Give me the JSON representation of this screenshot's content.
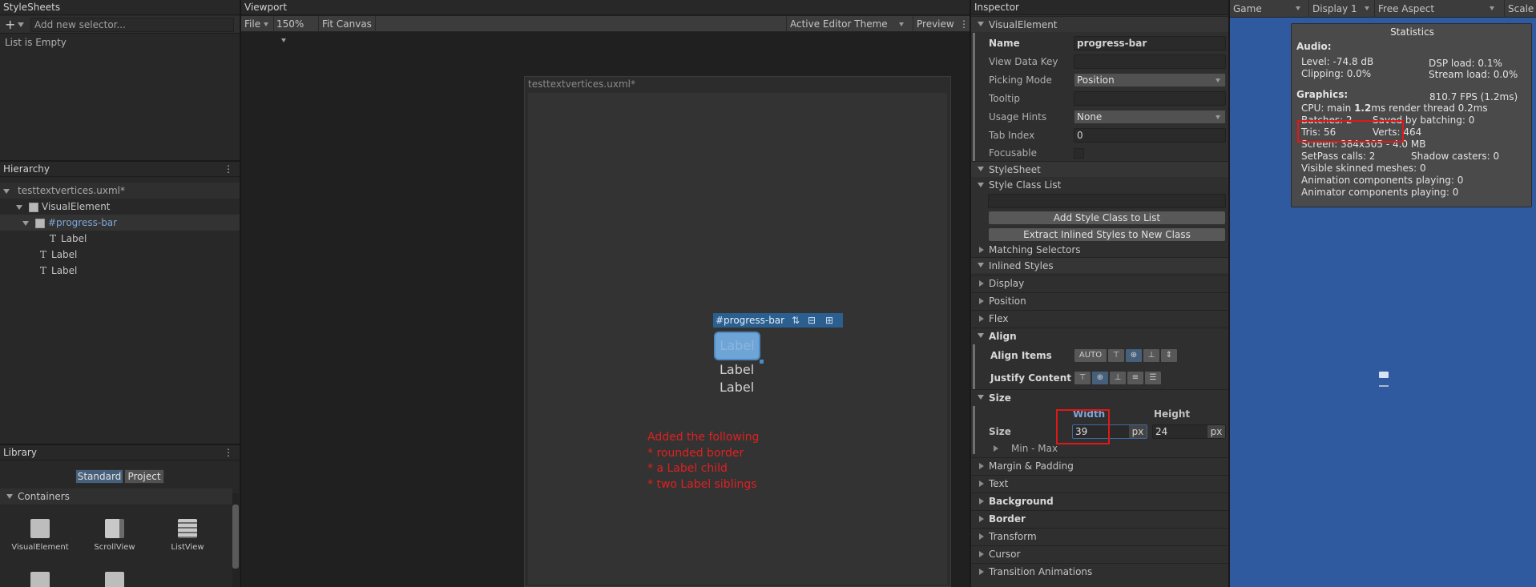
{
  "stylesheets": {
    "title": "StyleSheets",
    "add_placeholder": "Add new selector...",
    "empty": "List is Empty"
  },
  "hierarchy": {
    "title": "Hierarchy",
    "root": "testtextvertices.uxml*",
    "items": [
      {
        "label": "VisualElement"
      },
      {
        "label": "#progress-bar"
      },
      {
        "label": "Label"
      },
      {
        "label": "Label"
      },
      {
        "label": "Label"
      }
    ]
  },
  "library": {
    "title": "Library",
    "tabs": [
      "Standard",
      "Project"
    ],
    "section": "Containers",
    "cards": [
      "VisualElement",
      "ScrollView",
      "ListView"
    ]
  },
  "viewport": {
    "title": "Viewport",
    "file_menu": "File",
    "zoom": "150%",
    "fit": "Fit Canvas",
    "theme": "Active Editor Theme",
    "preview": "Preview",
    "canvas_title": "testtextvertices.uxml*",
    "selected_tag": "#progress-bar",
    "child_label": "Label",
    "sibling1": "Label",
    "sibling2": "Label",
    "annotation": [
      "Added the following",
      "* rounded border",
      "* a Label child",
      "* two Label siblings"
    ]
  },
  "inspector": {
    "title": "Inspector",
    "header": "VisualElement",
    "fields": {
      "name_label": "Name",
      "name_value": "progress-bar",
      "view_data_key": "View Data Key",
      "picking_mode": "Picking Mode",
      "picking_value": "Position",
      "tooltip": "Tooltip",
      "usage_hints": "Usage Hints",
      "usage_value": "None",
      "tab_index": "Tab Index",
      "tab_value": "0",
      "focusable": "Focusable"
    },
    "stylesheet": "StyleSheet",
    "style_class_list": "Style Class List",
    "add_class_btn": "Add Style Class to List",
    "extract_btn": "Extract Inlined Styles to New Class",
    "matching": "Matching Selectors",
    "inlined": "Inlined Styles",
    "display": "Display",
    "position": "Position",
    "flex": "Flex",
    "align": "Align",
    "align_items": "Align Items",
    "align_auto": "AUTO",
    "justify": "Justify Content",
    "size": "Size",
    "size_label": "Size",
    "width_label": "Width",
    "width_value": "39",
    "height_label": "Height",
    "height_value": "24",
    "unit": "px",
    "minmax": "Min - Max",
    "margin": "Margin & Padding",
    "text": "Text",
    "background": "Background",
    "border": "Border",
    "transform": "Transform",
    "cursor": "Cursor",
    "transition": "Transition Animations"
  },
  "game": {
    "tab": "Game",
    "display": "Display 1",
    "aspect": "Free Aspect",
    "scale": "Scale",
    "stats": {
      "title": "Statistics",
      "audio": "Audio:",
      "level": "Level: -74.8 dB",
      "dsp": "DSP load: 0.1%",
      "clipping": "Clipping: 0.0%",
      "stream": "Stream load: 0.0%",
      "graphics": "Graphics:",
      "fps": "810.7 FPS (1.2ms)",
      "cpu_prefix": "CPU: main ",
      "cpu_main": "1.2",
      "cpu_rest": "ms  render thread 0.2ms",
      "batches": "Batches: 2",
      "saved": "Saved by batching: 0",
      "tris": "Tris: 56",
      "verts": "Verts: 464",
      "screen": "Screen: 384x305 - 4.0 MB",
      "setpass": "SetPass calls: 2",
      "shadow": "Shadow casters: 0",
      "skinned": "Visible skinned meshes: 0",
      "anim": "Animation components playing: 0",
      "animator": "Animator components playing: 0"
    }
  },
  "colors": {
    "accent": "#4d8ac4",
    "annotation": "#e02020",
    "game_bg": "#2f5aa0"
  }
}
